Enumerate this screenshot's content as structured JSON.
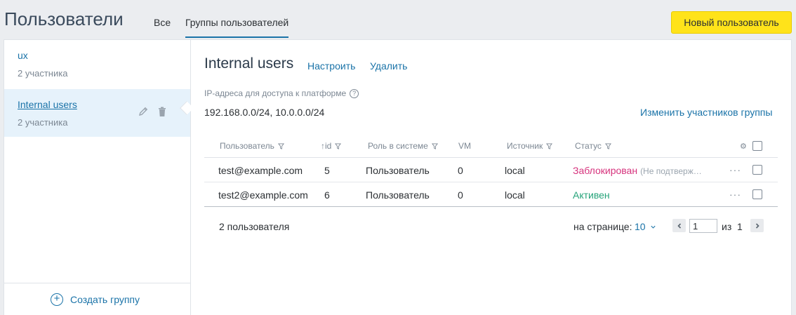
{
  "header": {
    "title": "Пользователи",
    "tabs": [
      {
        "label": "Все",
        "active": false
      },
      {
        "label": "Группы пользователей",
        "active": true
      }
    ],
    "new_user_label": "Новый пользователь"
  },
  "sidebar": {
    "groups": [
      {
        "name": "ux",
        "count": "2 участника",
        "active": false
      },
      {
        "name": "Internal users",
        "count": "2 участника",
        "active": true
      }
    ],
    "create_group_label": "Создать группу"
  },
  "group": {
    "title": "Internal users",
    "configure_label": "Настроить",
    "delete_label": "Удалить",
    "ip_label": "IP-адреса для доступа к платформе",
    "ip_value": "192.168.0.0/24, 10.0.0.0/24",
    "edit_members_label": "Изменить участников группы"
  },
  "table": {
    "columns": [
      "Пользователь",
      "id",
      "Роль в системе",
      "VM",
      "Источник",
      "Статус"
    ],
    "sort_indicator": "↑",
    "rows": [
      {
        "user": "test@example.com",
        "id": "5",
        "role": "Пользователь",
        "vm": "0",
        "source": "local",
        "status": "Заблокирован",
        "note": "(Не подтверж…"
      },
      {
        "user": "test2@example.com",
        "id": "6",
        "role": "Пользователь",
        "vm": "0",
        "source": "local",
        "status": "Активен",
        "note": ""
      }
    ]
  },
  "footer": {
    "count": "2 пользователя",
    "per_page_label": "на странице:",
    "per_page_value": "10",
    "page": "1",
    "of_label": "из",
    "total_pages": "1"
  },
  "colors": {
    "accent": "#1a73a8",
    "primary_button": "#ffe31a",
    "blocked": "#d6337d",
    "active": "#26a37a"
  }
}
